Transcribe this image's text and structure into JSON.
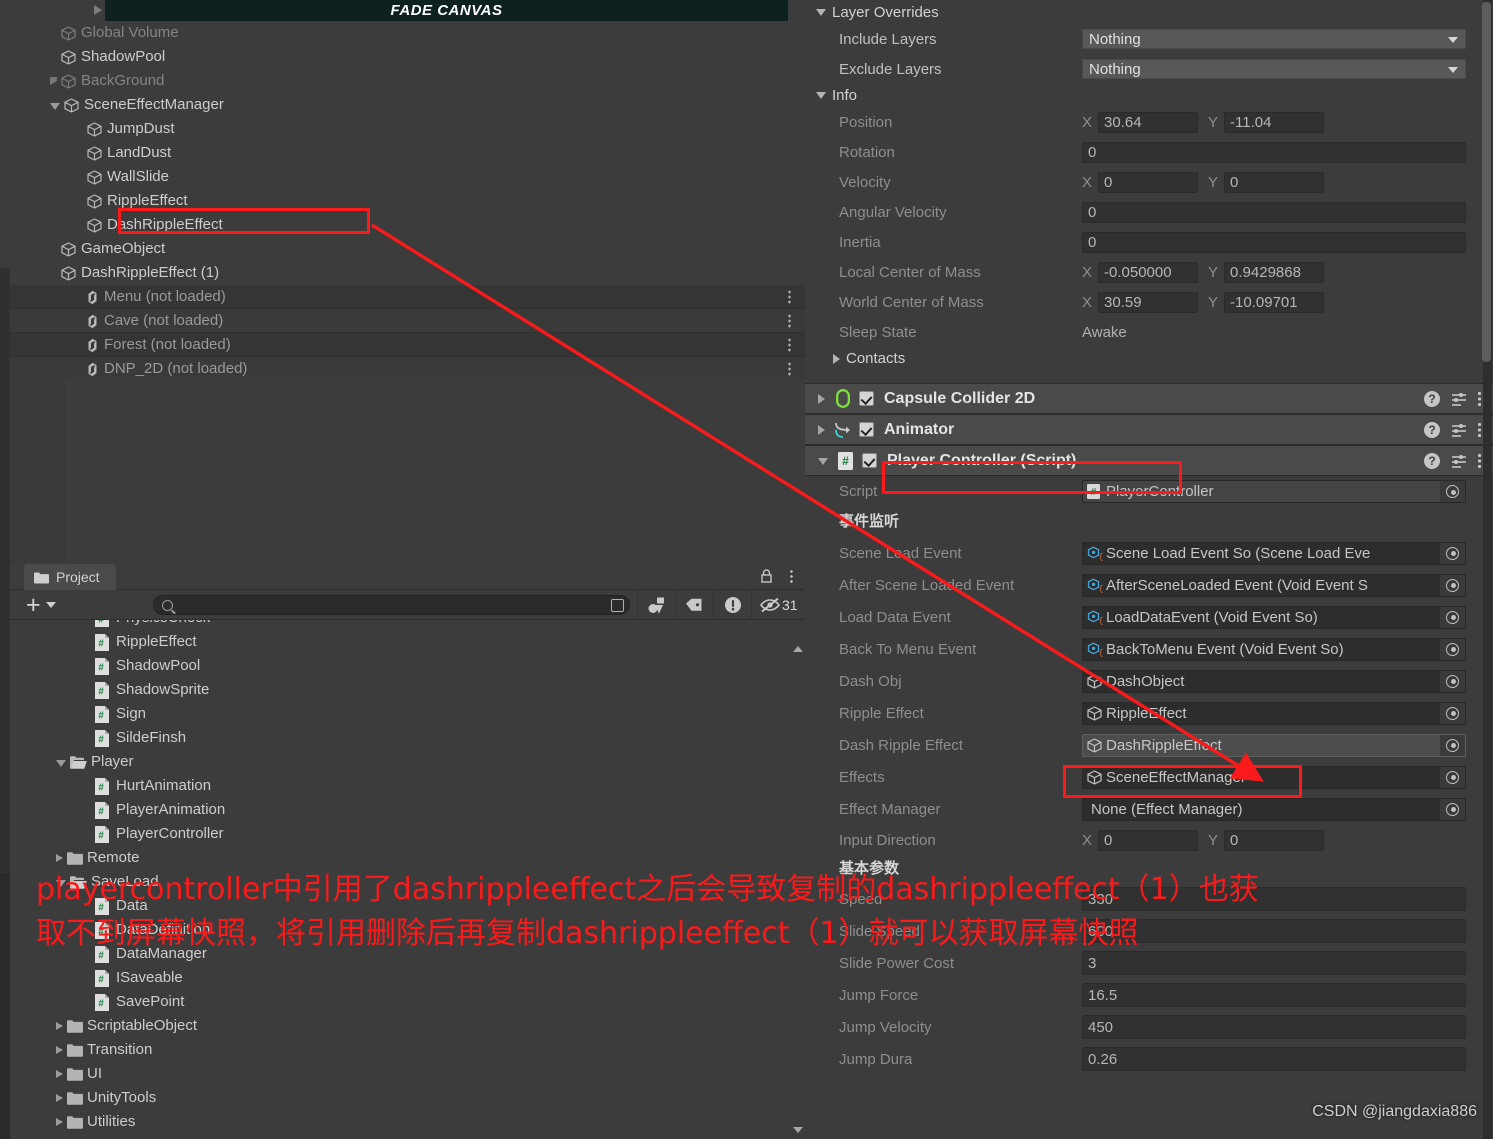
{
  "hierarchy": {
    "fade_canvas_label": "FADE CANVAS",
    "items": [
      {
        "label": "Global Volume",
        "indent": 1,
        "dim": true,
        "arrow": "none",
        "icon": "gameobject-icon"
      },
      {
        "label": "ShadowPool",
        "indent": 1,
        "dim": false,
        "arrow": "none",
        "icon": "gameobject-icon"
      },
      {
        "label": "BackGround",
        "indent": 1,
        "dim": true,
        "arrow": "closed",
        "icon": "gameobject-icon"
      },
      {
        "label": "SceneEffectManager",
        "indent": 1,
        "dim": false,
        "arrow": "open",
        "icon": "gameobject-icon"
      },
      {
        "label": "JumpDust",
        "indent": 2,
        "dim": false,
        "arrow": "none",
        "icon": "gameobject-icon"
      },
      {
        "label": "LandDust",
        "indent": 2,
        "dim": false,
        "arrow": "none",
        "icon": "gameobject-icon"
      },
      {
        "label": "WallSlide",
        "indent": 2,
        "dim": false,
        "arrow": "none",
        "icon": "gameobject-icon"
      },
      {
        "label": "RippleEffect",
        "indent": 2,
        "dim": false,
        "arrow": "none",
        "icon": "gameobject-icon"
      },
      {
        "label": "DashRippleEffect",
        "indent": 2,
        "dim": false,
        "arrow": "none",
        "icon": "gameobject-icon"
      },
      {
        "label": "GameObject",
        "indent": 1,
        "dim": false,
        "arrow": "none",
        "icon": "gameobject-icon"
      },
      {
        "label": "DashRippleEffect (1)",
        "indent": 1,
        "dim": false,
        "arrow": "none",
        "icon": "gameobject-icon"
      }
    ],
    "scenes": [
      {
        "label": "Menu (not loaded)"
      },
      {
        "label": "Cave (not loaded)"
      },
      {
        "label": "Forest (not loaded)"
      },
      {
        "label": "DNP_2D (not loaded)"
      }
    ]
  },
  "project": {
    "tab_label": "Project",
    "search_value": "",
    "search_placeholder": "",
    "hidden_count": "31",
    "tree": [
      {
        "label": "PhysicsCheck",
        "type": "script",
        "indent": 2
      },
      {
        "label": "RippleEffect",
        "type": "script",
        "indent": 2
      },
      {
        "label": "ShadowPool",
        "type": "script",
        "indent": 2
      },
      {
        "label": "ShadowSprite",
        "type": "script",
        "indent": 2
      },
      {
        "label": "Sign",
        "type": "script",
        "indent": 2
      },
      {
        "label": "SildeFinsh",
        "type": "script",
        "indent": 2
      },
      {
        "label": "Player",
        "type": "folder-open",
        "indent": 1
      },
      {
        "label": "HurtAnimation",
        "type": "script",
        "indent": 2
      },
      {
        "label": "PlayerAnimation",
        "type": "script",
        "indent": 2
      },
      {
        "label": "PlayerController",
        "type": "script",
        "indent": 2
      },
      {
        "label": "Remote",
        "type": "folder",
        "indent": 1
      },
      {
        "label": "SaveLoad",
        "type": "folder-open",
        "indent": 1
      },
      {
        "label": "Data",
        "type": "script",
        "indent": 2
      },
      {
        "label": "DataDefinition",
        "type": "script",
        "indent": 2
      },
      {
        "label": "DataManager",
        "type": "script",
        "indent": 2
      },
      {
        "label": "ISaveable",
        "type": "script",
        "indent": 2
      },
      {
        "label": "SavePoint",
        "type": "script",
        "indent": 2
      },
      {
        "label": "ScriptableObject",
        "type": "folder",
        "indent": 1
      },
      {
        "label": "Transition",
        "type": "folder",
        "indent": 1
      },
      {
        "label": "UI",
        "type": "folder",
        "indent": 1
      },
      {
        "label": "UnityTools",
        "type": "folder",
        "indent": 1
      },
      {
        "label": "Utilities",
        "type": "folder",
        "indent": 1
      }
    ]
  },
  "inspector": {
    "layer_overrides": {
      "title": "Layer Overrides",
      "include_label": "Include Layers",
      "include_value": "Nothing",
      "exclude_label": "Exclude Layers",
      "exclude_value": "Nothing"
    },
    "info": {
      "title": "Info",
      "position_label": "Position",
      "position_x": "30.64",
      "position_y": "-11.04",
      "rotation_label": "Rotation",
      "rotation_value": "0",
      "velocity_label": "Velocity",
      "velocity_x": "0",
      "velocity_y": "0",
      "angular_velocity_label": "Angular Velocity",
      "angular_velocity_value": "0",
      "inertia_label": "Inertia",
      "inertia_value": "0",
      "local_com_label": "Local Center of Mass",
      "local_com_x": "-0.050000",
      "local_com_y": "0.9429868",
      "world_com_label": "World Center of Mass",
      "world_com_x": "30.59",
      "world_com_y": "-10.09701",
      "sleep_state_label": "Sleep State",
      "sleep_state_value": "Awake",
      "contacts_label": "Contacts"
    },
    "components": [
      {
        "name": "Capsule Collider 2D",
        "icon": "capsule-collider-icon",
        "expanded": false,
        "enabled": true
      },
      {
        "name": "Animator",
        "icon": "animator-icon",
        "expanded": false,
        "enabled": true
      },
      {
        "name": "Player Controller (Script)",
        "icon": "script-icon",
        "expanded": true,
        "enabled": true
      }
    ],
    "script_row": {
      "label": "Script",
      "value": "PlayerController"
    },
    "event_group_title": "事件监听",
    "event_fields": [
      {
        "label": "Scene Load Event",
        "value": "Scene Load Event So (Scene Load Eve",
        "icon": "scriptable-object-icon",
        "selected": false
      },
      {
        "label": "After Scene Loaded Event",
        "value": "AfterSceneLoaded Event (Void Event S",
        "icon": "scriptable-object-icon",
        "selected": false
      },
      {
        "label": "Load Data Event",
        "value": "LoadDataEvent (Void Event So)",
        "icon": "scriptable-object-icon",
        "selected": false
      },
      {
        "label": "Back To Menu Event",
        "value": "BackToMenu Event (Void Event So)",
        "icon": "scriptable-object-icon",
        "selected": false
      },
      {
        "label": "Dash Obj",
        "value": "DashObject",
        "icon": "gameobject-icon",
        "selected": false
      },
      {
        "label": "Ripple Effect",
        "value": "RippleEffect",
        "icon": "gameobject-icon",
        "selected": false
      },
      {
        "label": "Dash Ripple Effect",
        "value": "DashRippleEffect",
        "icon": "gameobject-icon",
        "selected": true
      },
      {
        "label": "Effects",
        "value": "SceneEffectManager",
        "icon": "gameobject-icon",
        "selected": false
      },
      {
        "label": "Effect Manager",
        "value": "None (Effect Manager)",
        "icon": "none",
        "selected": false
      }
    ],
    "input_direction": {
      "label": "Input Direction",
      "x": "0",
      "y": "0"
    },
    "params_group_title": "基本参数",
    "params": [
      {
        "label": "Speed",
        "value": "330"
      },
      {
        "label": "Slide Speed",
        "value": "600"
      },
      {
        "label": "Slide Power Cost",
        "value": "3"
      },
      {
        "label": "Jump Force",
        "value": "16.5"
      },
      {
        "label": "Jump Velocity",
        "value": "450"
      },
      {
        "label": "Jump Dura",
        "value": "0.26"
      }
    ]
  },
  "annotation": {
    "line1": "playercontroller中引用了dashrippleeffect之后会导致复制的dashrippleeffect（1）也获",
    "line2": "取不到屏幕快照，将引用删除后再复制dashrippleeffect（1）就可以获取屏幕快照",
    "color": "#f91b1b"
  },
  "watermark": "CSDN @jiangdaxia886"
}
